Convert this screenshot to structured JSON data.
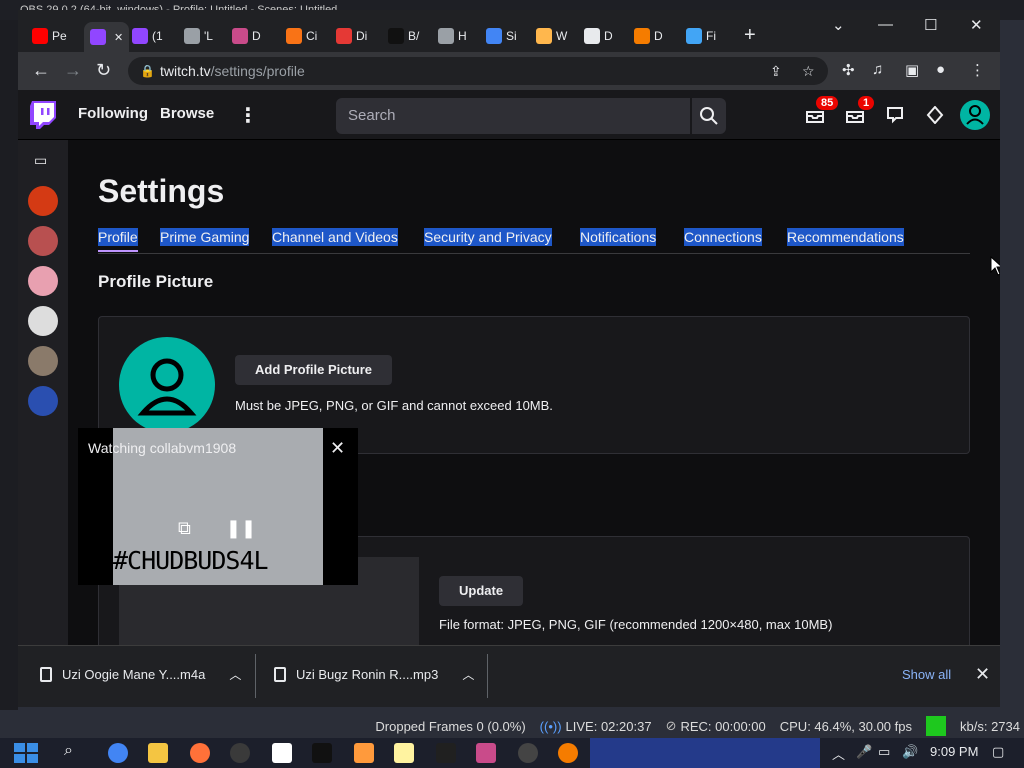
{
  "obs": {
    "title": "OBS 29.0.2 (64-bit, windows) - Profile: Untitled - Scenes: Untitled",
    "status": {
      "dropped_frames": "Dropped Frames 0 (0.0%)",
      "live": "LIVE: 02:20:37",
      "rec": "REC: 00:00:00",
      "cpu": "CPU: 46.4%, 30.00 fps",
      "kbs": "kb/s: 2734"
    }
  },
  "browser": {
    "tabs": [
      {
        "label": "Pe",
        "icon": "youtube-icon",
        "color": "#ff0000"
      },
      {
        "label": "",
        "icon": "twitch-icon",
        "color": "#9146ff",
        "active": true
      },
      {
        "label": "(1",
        "icon": "twitch-icon",
        "color": "#9146ff"
      },
      {
        "label": "'L",
        "icon": "globe-icon",
        "color": "#9aa0a6"
      },
      {
        "label": "D",
        "icon": "x-icon",
        "color": "#c94b8a"
      },
      {
        "label": "Ci",
        "icon": "orange-square-icon",
        "color": "#f97316"
      },
      {
        "label": "Di",
        "icon": "store-icon",
        "color": "#e53935"
      },
      {
        "label": "B/",
        "icon": "dark-logo-icon",
        "color": "#111111"
      },
      {
        "label": "H",
        "icon": "globe-icon",
        "color": "#9aa0a6"
      },
      {
        "label": "Si",
        "icon": "google-icon",
        "color": "#4285f4"
      },
      {
        "label": "W",
        "icon": "image-icon",
        "color": "#ffb74d"
      },
      {
        "label": "D",
        "icon": "download-icon",
        "color": "#e8eaed"
      },
      {
        "label": "D",
        "icon": "circle-icon",
        "color": "#f57c00"
      },
      {
        "label": "Fi",
        "icon": "blue-icon",
        "color": "#42a5f5"
      }
    ],
    "url_host": "twitch.tv",
    "url_path": "/settings/profile"
  },
  "twitch": {
    "nav": {
      "following": "Following",
      "browse": "Browse",
      "search_placeholder": "Search",
      "badge_whispers": "85",
      "badge_inbox": "1"
    },
    "settings_title": "Settings",
    "tabs": [
      "Profile",
      "Prime Gaming",
      "Channel and Videos",
      "Security and Privacy",
      "Notifications",
      "Connections",
      "Recommendations"
    ],
    "section_title": "Profile Picture",
    "add_picture": "Add Profile Picture",
    "picture_note": "Must be JPEG, PNG, or GIF and cannot exceed 10MB.",
    "update": "Update",
    "banner_note": "File format: JPEG, PNG, GIF (recommended 1200×480, max 10MB)",
    "mini_player": {
      "label": "Watching collabvm1908",
      "overlay_text": "#CHUDBUDS4L"
    }
  },
  "downloads": {
    "items": [
      "Uzi Oogie Mane Y....m4a",
      "Uzi Bugz Ronin R....mp3"
    ],
    "show_all": "Show all"
  },
  "taskbar": {
    "time": "9:09 PM"
  }
}
